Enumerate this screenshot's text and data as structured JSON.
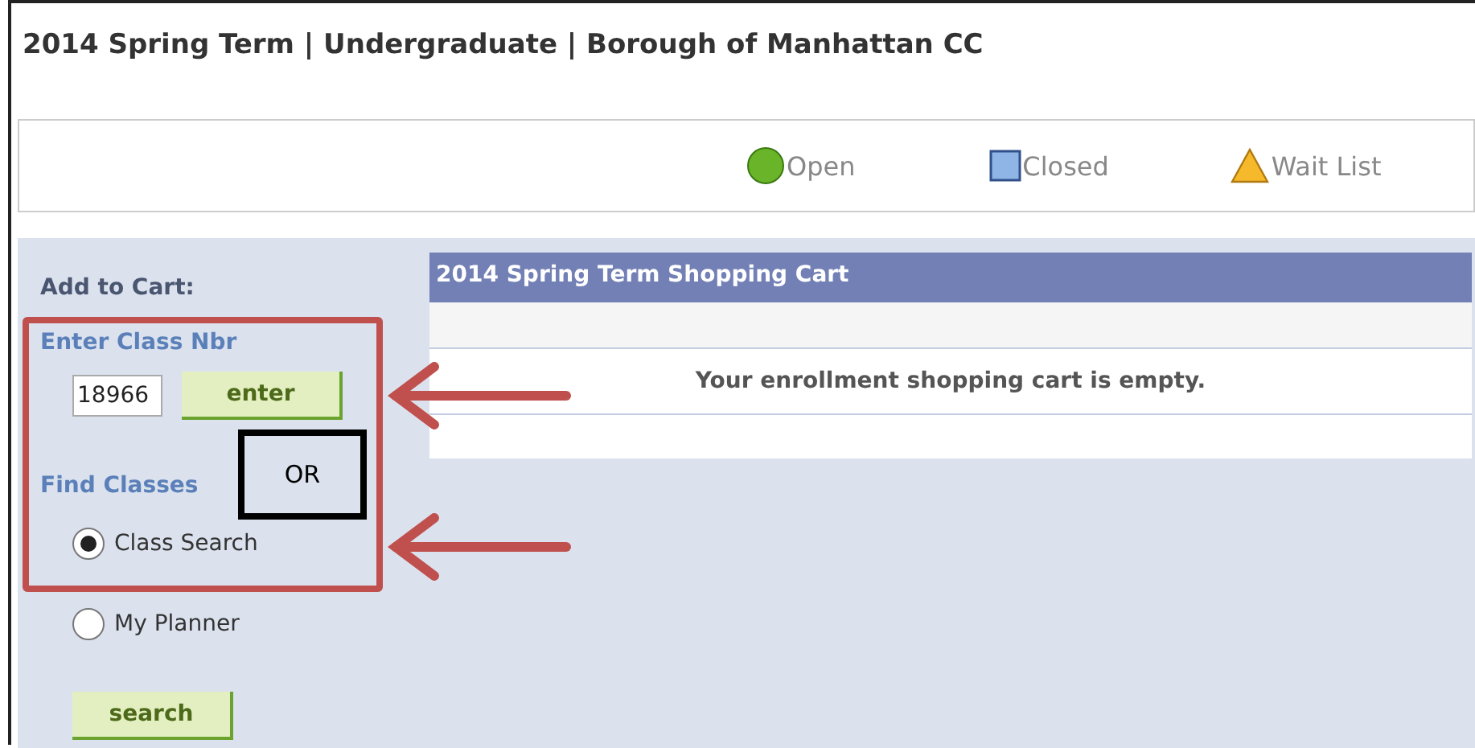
{
  "title": "2014 Spring Term | Undergraduate | Borough of Manhattan CC",
  "legend": [
    {
      "kind": "circle",
      "label": "Open",
      "color": "#6ab42a"
    },
    {
      "kind": "square",
      "label": "Closed",
      "color": "#8fb4e6"
    },
    {
      "kind": "triangle",
      "label": "Wait List",
      "color": "#f6b92b"
    }
  ],
  "add_to_cart": {
    "heading": "Add to Cart:",
    "enter_label": "Enter Class Nbr",
    "class_nbr": "18966",
    "enter_button": "enter",
    "find_label": "Find Classes",
    "options": [
      {
        "label": "Class Search",
        "selected": true
      },
      {
        "label": "My Planner",
        "selected": false
      }
    ],
    "search_button": "search"
  },
  "cart": {
    "title": "2014 Spring Term Shopping Cart",
    "message": "Your enrollment shopping cart is empty."
  },
  "annotation": {
    "or_label": "OR"
  }
}
